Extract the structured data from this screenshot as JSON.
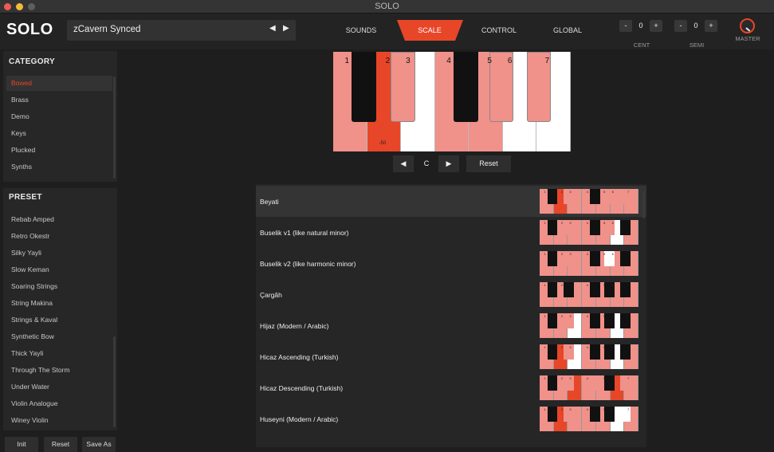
{
  "window": {
    "title": "SOLO"
  },
  "header": {
    "logo": "SOLO",
    "sound_name": "zCavern Synced",
    "prev_icon": "◀",
    "next_icon": "▶",
    "tabs": [
      {
        "label": "SOUNDS",
        "active": false
      },
      {
        "label": "SCALE",
        "active": true
      },
      {
        "label": "CONTROL",
        "active": false
      },
      {
        "label": "GLOBAL",
        "active": false
      }
    ],
    "cent": {
      "label": "CENT",
      "value": "0",
      "minus": "-",
      "plus": "+"
    },
    "semi": {
      "label": "SEMI",
      "value": "0",
      "minus": "-",
      "plus": "+"
    },
    "master": {
      "label": "MASTER"
    }
  },
  "sidebar": {
    "category_title": "CATEGORY",
    "categories": [
      "Bowed",
      "Brass",
      "Demo",
      "Keys",
      "Plucked",
      "Synths"
    ],
    "selected_category": "Bowed",
    "preset_title": "PRESET",
    "presets": [
      "Rebab Amped",
      "Retro Okestr",
      "Silky Yayli",
      "Slow Keman",
      "Soaring Strings",
      "String Makina",
      "Strings & Kaval",
      "Synthetic Bow",
      "Thick Yayli",
      "Through The Storm",
      "Under Water",
      "Violin Analogue",
      "Winey Violin"
    ],
    "buttons": {
      "init": "Init",
      "reset": "Reset",
      "save_as": "Save As"
    }
  },
  "scale": {
    "key_numbers": [
      "1",
      "2",
      "3",
      "4",
      "5",
      "6",
      "7"
    ],
    "detune_label": "-50",
    "root_key": "C",
    "reset_label": "Reset",
    "colors": {
      "accent": "#e84628",
      "salmon": "#f0918a",
      "black": "#111111",
      "white": "#ffffff"
    },
    "scales": [
      {
        "name": "Beyati"
      },
      {
        "name": "Buselik v1 (like natural minor)"
      },
      {
        "name": "Buselik v2 (like harmonic minor)"
      },
      {
        "name": "Çargâh"
      },
      {
        "name": "Hijaz (Modern / Arabic)"
      },
      {
        "name": "Hicaz Ascending (Turkish)"
      },
      {
        "name": "Hicaz Descending (Turkish)"
      },
      {
        "name": "Huseyni (Modern / Arabic)"
      }
    ],
    "selected_scale": "Beyati"
  }
}
